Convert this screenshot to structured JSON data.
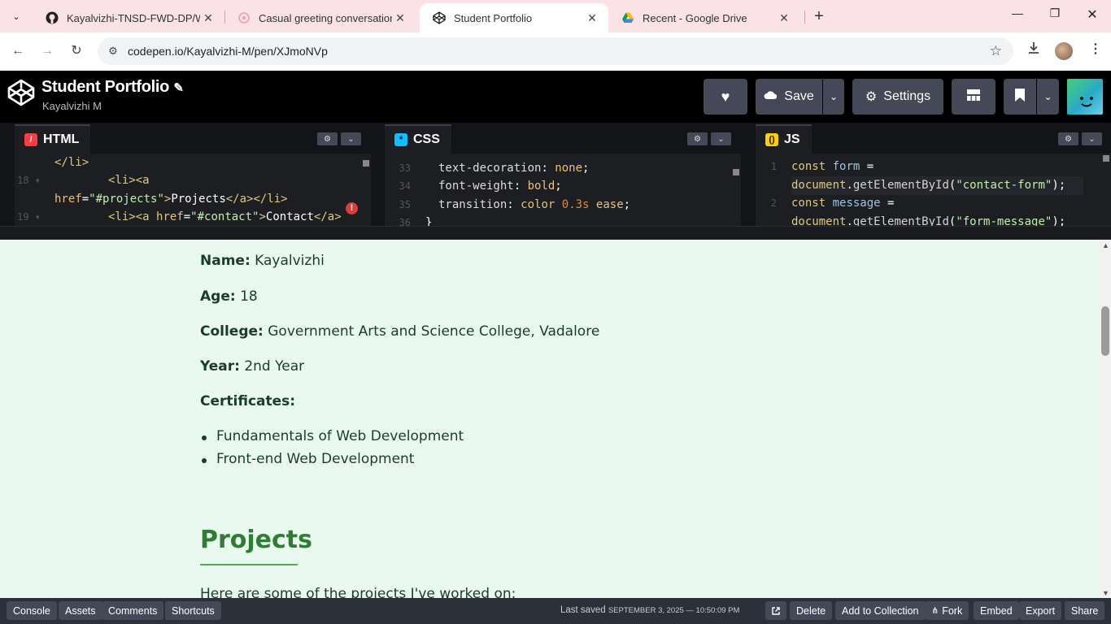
{
  "browser": {
    "tabs": [
      {
        "title": "Kayalvizhi-TNSD-FWD-DP/Wha",
        "icon": "github-icon"
      },
      {
        "title": "Casual greeting conversation",
        "icon": "chat-icon"
      },
      {
        "title": "Student Portfolio",
        "icon": "codepen-icon",
        "active": true
      },
      {
        "title": "Recent - Google Drive",
        "icon": "google-drive-icon"
      }
    ],
    "url": "codepen.io/Kayalvizhi-M/pen/XJmoNVp"
  },
  "header": {
    "title": "Student Portfolio",
    "author": "Kayalvizhi M",
    "save_label": "Save",
    "settings_label": "Settings"
  },
  "editors": {
    "html": {
      "label": "HTML",
      "accent": "#ff3c41"
    },
    "css": {
      "label": "CSS",
      "accent": "#0ebeff"
    },
    "js": {
      "label": "JS",
      "accent": "#fcd000"
    }
  },
  "preview": {
    "name_label": "Name:",
    "name_value": "Kayalvizhi",
    "age_label": "Age:",
    "age_value": "18",
    "college_label": "College:",
    "college_value": "Government Arts and Science College, Vadalore",
    "year_label": "Year:",
    "year_value": "2nd Year",
    "certificates_label": "Certificates:",
    "certificates": [
      "Fundamentals of Web Development",
      "Front-end Web Development"
    ],
    "projects_heading": "Projects",
    "projects_intro": "Here are some of the projects I've worked on:"
  },
  "footer": {
    "console": "Console",
    "assets": "Assets",
    "comments": "Comments",
    "shortcuts": "Shortcuts",
    "last_saved_label": "Last saved",
    "last_saved_time": "SEPTEMBER 3, 2025 — 10:50:09 PM",
    "delete": "Delete",
    "add_to_collection": "Add to Collection",
    "fork": "Fork",
    "embed": "Embed",
    "export": "Export",
    "share": "Share"
  }
}
